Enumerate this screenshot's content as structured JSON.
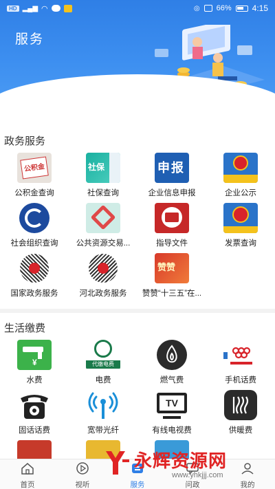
{
  "status_bar": {
    "left_chip": "HD",
    "battery": "66%",
    "time": "4:15"
  },
  "header": {
    "title": "服务"
  },
  "sections": {
    "gov": {
      "title": "政务服务",
      "items": [
        {
          "label": "公积金查询",
          "icon": "housing-fund-icon"
        },
        {
          "label": "社保查询",
          "icon": "social-security-icon"
        },
        {
          "label": "企业信息申报",
          "icon": "enterprise-report-icon"
        },
        {
          "label": "企业公示",
          "icon": "enterprise-publicity-icon"
        },
        {
          "label": "社会组织查询",
          "icon": "social-org-icon"
        },
        {
          "label": "公共资源交易...",
          "icon": "public-resource-icon"
        },
        {
          "label": "指导文件",
          "icon": "guidance-doc-icon"
        },
        {
          "label": "发票查询",
          "icon": "invoice-icon"
        },
        {
          "label": "国家政务服务",
          "icon": "national-gov-qr-icon"
        },
        {
          "label": "河北政务服务",
          "icon": "hebei-gov-qr-icon"
        },
        {
          "label": "赞赞“十三五”在...",
          "icon": "promo-banner-icon"
        }
      ]
    },
    "life": {
      "title": "生活缴费",
      "items": [
        {
          "label": "水费",
          "icon": "water-icon"
        },
        {
          "label": "电费",
          "icon": "electricity-icon"
        },
        {
          "label": "燃气费",
          "icon": "gas-flame-icon"
        },
        {
          "label": "手机话费",
          "icon": "mobile-icon"
        },
        {
          "label": "固话话费",
          "icon": "landline-icon"
        },
        {
          "label": "宽带光纤",
          "icon": "broadband-icon"
        },
        {
          "label": "有线电视费",
          "icon": "tv-icon"
        },
        {
          "label": "供暖费",
          "icon": "heating-icon"
        }
      ]
    }
  },
  "icon_texts": {
    "housing_fund": "公积金",
    "social_security": "社保",
    "enterprise_report": "申报",
    "electricity_caption": "代缴电费",
    "tv": "TV",
    "promo": "赞赞"
  },
  "nav": [
    {
      "label": "首页",
      "icon": "home-icon"
    },
    {
      "label": "视听",
      "icon": "play-icon"
    },
    {
      "label": "服务",
      "icon": "service-icon",
      "active": true
    },
    {
      "label": "问政",
      "icon": "inquiry-icon"
    },
    {
      "label": "我的",
      "icon": "profile-icon"
    }
  ],
  "watermark": {
    "text": "永辉资源网",
    "url": "www.yhkjjj.com"
  },
  "colors": {
    "primary": "#2f7fe6",
    "watermark": "#e02424"
  }
}
